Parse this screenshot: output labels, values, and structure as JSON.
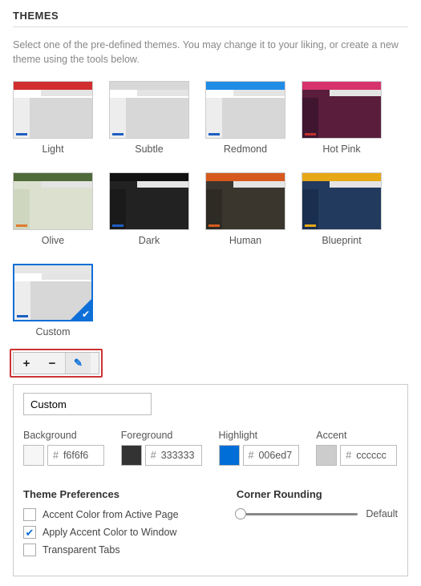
{
  "section_title": "THEMES",
  "description": "Select one of the pre-defined themes. You may change it to your liking, or create a new theme using the tools below.",
  "themes": [
    {
      "name": "Light",
      "titlebar": "#d12f2f",
      "tab": "#ffffff",
      "sidebar": "#ededed",
      "main": "#d7d7d7",
      "status": "#1e5fc2"
    },
    {
      "name": "Subtle",
      "titlebar": "#d8d8d8",
      "tab": "#ffffff",
      "sidebar": "#ededed",
      "main": "#d7d7d7",
      "status": "#1e5fc2"
    },
    {
      "name": "Redmond",
      "titlebar": "#1f8ce6",
      "tab": "#ffffff",
      "sidebar": "#ededed",
      "main": "#d7d7d7",
      "status": "#1e5fc2"
    },
    {
      "name": "Hot Pink",
      "titlebar": "#d6336c",
      "tab": "#5a1e3c",
      "sidebar": "#401530",
      "main": "#5a1e3c",
      "status": "#c2322e"
    },
    {
      "name": "Olive",
      "titlebar": "#4f6b3a",
      "tab": "#dbe0cf",
      "sidebar": "#cfd6bf",
      "main": "#dbe0cf",
      "status": "#e07b2e"
    },
    {
      "name": "Dark",
      "titlebar": "#111111",
      "tab": "#222222",
      "sidebar": "#1a1a1a",
      "main": "#222222",
      "status": "#1e5fc2"
    },
    {
      "name": "Human",
      "titlebar": "#d65a1e",
      "tab": "#3a362e",
      "sidebar": "#2e2b24",
      "main": "#3a362e",
      "status": "#d65a1e"
    },
    {
      "name": "Blueprint",
      "titlebar": "#e6a817",
      "tab": "#223a5e",
      "sidebar": "#1a2f4f",
      "main": "#223a5e",
      "status": "#e6a817"
    },
    {
      "name": "Custom",
      "titlebar": "#e6e6e6",
      "tab": "#ffffff",
      "sidebar": "#ededed",
      "main": "#d7d7d7",
      "status": "#1e5fc2",
      "selected": true
    }
  ],
  "toolbar": {
    "add": "+",
    "remove": "−",
    "edit": "✎"
  },
  "theme_name_input": "Custom",
  "colors": {
    "background": {
      "label": "Background",
      "swatch": "#f6f6f6",
      "hex": "f6f6f6"
    },
    "foreground": {
      "label": "Foreground",
      "swatch": "#333333",
      "hex": "333333"
    },
    "highlight": {
      "label": "Highlight",
      "swatch": "#006ed7",
      "hex": "006ed7"
    },
    "accent": {
      "label": "Accent",
      "swatch": "#cccccc",
      "hex": "cccccc"
    }
  },
  "prefs": {
    "title": "Theme Preferences",
    "items": [
      {
        "label": "Accent Color from Active Page",
        "checked": false
      },
      {
        "label": "Apply Accent Color to Window",
        "checked": true
      },
      {
        "label": "Transparent Tabs",
        "checked": false
      }
    ]
  },
  "corner": {
    "title": "Corner Rounding",
    "value_label": "Default",
    "position_pct": 0
  }
}
